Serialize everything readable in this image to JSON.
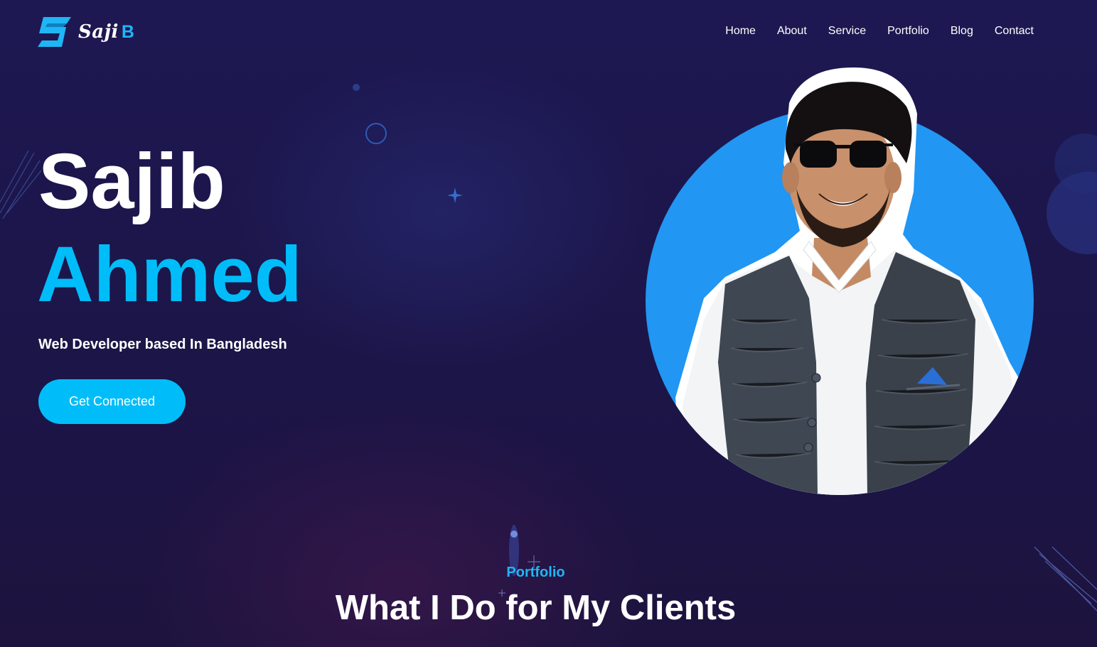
{
  "brand": {
    "name": "Saji",
    "name_accent": "B",
    "accent_color": "#1fb6f5"
  },
  "nav": {
    "items": [
      {
        "label": "Home"
      },
      {
        "label": "About"
      },
      {
        "label": "Service"
      },
      {
        "label": "Portfolio"
      },
      {
        "label": "Blog"
      },
      {
        "label": "Contact"
      }
    ]
  },
  "hero": {
    "first_name": "Sajib",
    "last_name": "Ahmed",
    "tagline": "Web Developer based In Bangladesh",
    "cta_label": "Get Connected",
    "name_accent_color": "#00bdf9",
    "portrait_bg_color": "#2196f3"
  },
  "portfolio_section": {
    "kicker": "Portfolio",
    "title": "What I Do for My Clients"
  },
  "theme": {
    "background": "#1c1548",
    "primary": "#00bdf9",
    "text": "#ffffff"
  }
}
